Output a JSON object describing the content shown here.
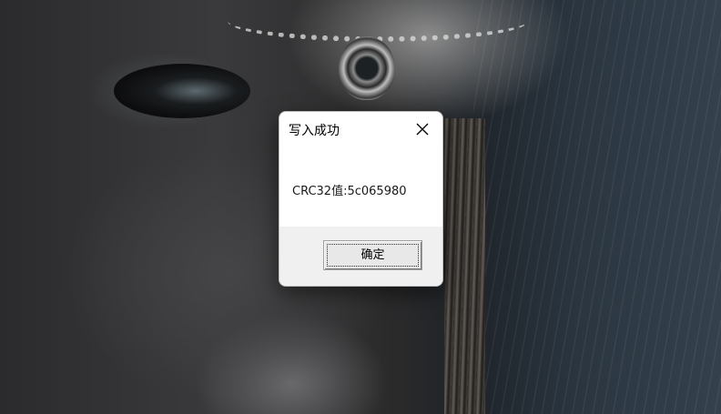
{
  "dialog": {
    "title": "写入成功",
    "message": "CRC32值:5c065980",
    "ok_label": "确定",
    "close_icon": "close-icon"
  },
  "background": {
    "description_colors": {
      "dialog_bg": "#ffffff",
      "footer_bg": "#f0f0f0"
    }
  }
}
